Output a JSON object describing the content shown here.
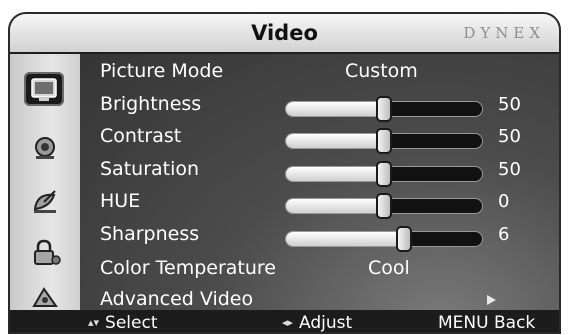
{
  "header": {
    "title": "Video",
    "brand": "DYNEX"
  },
  "sidebar": {
    "items": [
      {
        "icon": "tv-screen-icon",
        "selected": true
      },
      {
        "icon": "speaker-icon",
        "selected": false
      },
      {
        "icon": "satellite-dish-icon",
        "selected": false
      },
      {
        "icon": "lock-icon",
        "selected": false
      },
      {
        "icon": "setup-icon",
        "selected": false
      }
    ]
  },
  "menu": {
    "picture_mode": {
      "label": "Picture Mode",
      "value": "Custom"
    },
    "brightness": {
      "label": "Brightness",
      "value": "50",
      "level": 0.5
    },
    "contrast": {
      "label": "Contrast",
      "value": "50",
      "level": 0.5
    },
    "saturation": {
      "label": "Saturation",
      "value": "50",
      "level": 0.5
    },
    "hue": {
      "label": "HUE",
      "value": "0",
      "level": 0.5
    },
    "sharpness": {
      "label": "Sharpness",
      "value": "6",
      "level": 0.6
    },
    "color_temperature": {
      "label": "Color Temperature",
      "value": "Cool"
    },
    "advanced_video": {
      "label": "Advanced Video"
    }
  },
  "footer": {
    "select": "Select",
    "adjust": "Adjust",
    "menu_key": "MENU",
    "back": "Back"
  },
  "colors": {
    "osd_bg": "#3c3c3c",
    "header_bg": "#e0e0e0",
    "footer_bg": "#1c1c1c",
    "text": "#ffffff"
  }
}
